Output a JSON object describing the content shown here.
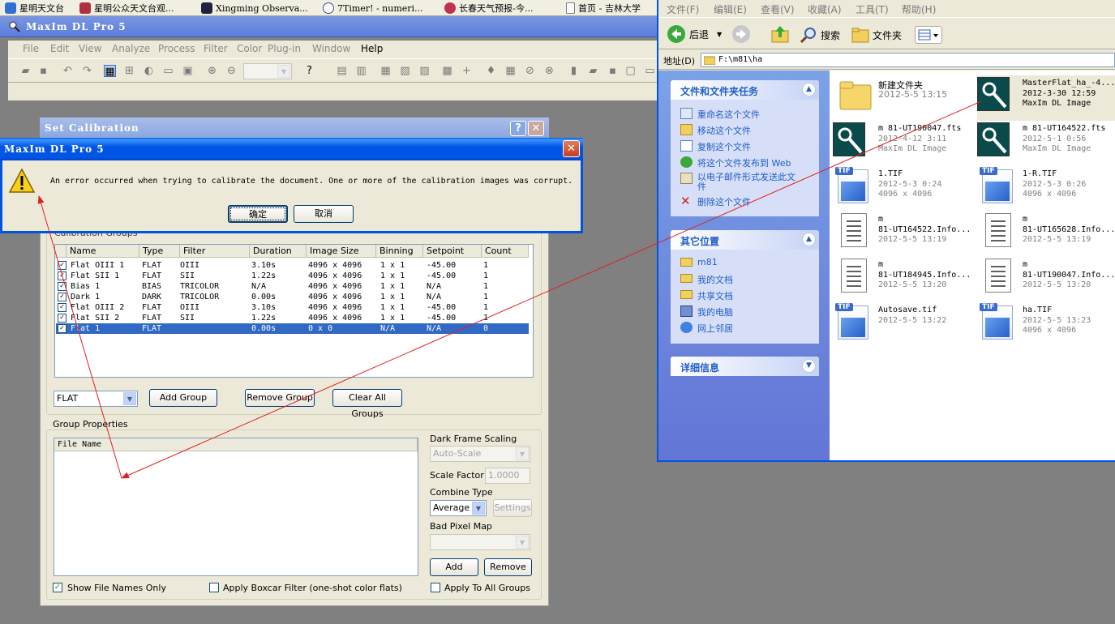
{
  "favorites": [
    {
      "label": "星明天文台",
      "color": "#3070d0"
    },
    {
      "label": "星明公众天文台观...",
      "color": "#b03040"
    },
    {
      "label": "Xingming Observa...",
      "color": "#202040"
    },
    {
      "label": "7Timer! - numeri...",
      "color": "#4040b0"
    },
    {
      "label": "长春天气预报-今...",
      "color": "#c03050"
    },
    {
      "label": "首页 - 吉林大学",
      "color": "#808080"
    }
  ],
  "maxim": {
    "title": "MaxIm DL Pro 5",
    "menu": [
      "File",
      "Edit",
      "View",
      "Analyze",
      "Process",
      "Filter",
      "Color",
      "Plug-in",
      "Window",
      "Help"
    ]
  },
  "set_calibration": {
    "title": "Set Calibration",
    "help_button": "?",
    "close_button": "✕",
    "groups_label": "Calibration Groups",
    "columns": [
      "Name",
      "Type",
      "Filter",
      "Duration",
      "Image Size",
      "Binning",
      "Setpoint",
      "Count"
    ],
    "rows": [
      {
        "checked": true,
        "name": "Flat OIII 1",
        "type": "FLAT",
        "filter": "OIII",
        "duration": "3.10s",
        "size": "4096 x 4096",
        "binning": "1 x 1",
        "setpoint": "-45.00",
        "count": "1",
        "selected": false
      },
      {
        "checked": true,
        "name": "Flat SII 1",
        "type": "FLAT",
        "filter": "SII",
        "duration": "1.22s",
        "size": "4096 x 4096",
        "binning": "1 x 1",
        "setpoint": "-45.00",
        "count": "1",
        "selected": false
      },
      {
        "checked": true,
        "name": "Bias 1",
        "type": "BIAS",
        "filter": "TRICOLOR",
        "duration": "N/A",
        "size": "4096 x 4096",
        "binning": "1 x 1",
        "setpoint": "N/A",
        "count": "1",
        "selected": false
      },
      {
        "checked": true,
        "name": "Dark 1",
        "type": "DARK",
        "filter": "TRICOLOR",
        "duration": "0.00s",
        "size": "4096 x 4096",
        "binning": "1 x 1",
        "setpoint": "N/A",
        "count": "1",
        "selected": false
      },
      {
        "checked": true,
        "name": "Flat OIII 2",
        "type": "FLAT",
        "filter": "OIII",
        "duration": "3.10s",
        "size": "4096 x 4096",
        "binning": "1 x 1",
        "setpoint": "-45.00",
        "count": "1",
        "selected": false
      },
      {
        "checked": true,
        "name": "Flat SII 2",
        "type": "FLAT",
        "filter": "SII",
        "duration": "1.22s",
        "size": "4096 x 4096",
        "binning": "1 x 1",
        "setpoint": "-45.00",
        "count": "1",
        "selected": false
      },
      {
        "checked": true,
        "name": "Flat 1",
        "type": "FLAT",
        "filter": "",
        "duration": "0.00s",
        "size": "0 x 0",
        "binning": "N/A",
        "setpoint": "N/A",
        "count": "0",
        "selected": true
      }
    ],
    "type_select": "FLAT",
    "add_group": "Add Group",
    "remove_group": "Remove Group",
    "clear_all_groups": "Clear All Groups",
    "group_properties": "Group Properties",
    "file_name_header": "File Name",
    "dark_frame_scaling": "Dark Frame Scaling",
    "dark_frame_scaling_value": "Auto-Scale",
    "scale_factor": "Scale Factor",
    "scale_factor_value": "1.0000",
    "combine_type": "Combine Type",
    "combine_type_value": "Average",
    "settings": "Settings",
    "bad_pixel_map": "Bad Pixel Map",
    "bad_pixel_map_value": "",
    "add": "Add",
    "remove": "Remove",
    "show_file_names_only": "Show File Names Only",
    "show_file_names_only_checked": true,
    "apply_boxcar": "Apply Boxcar Filter (one-shot color flats)",
    "apply_boxcar_checked": false,
    "apply_to_all_groups": "Apply To All Groups",
    "apply_to_all_groups_checked": false
  },
  "error_dialog": {
    "title": "MaxIm DL Pro 5",
    "message": "An error occurred when trying to calibrate the document.  One or more of the calibration images was corrupt.",
    "ok": "确定",
    "cancel": "取消",
    "close": "✕"
  },
  "explorer": {
    "menu": [
      "文件(F)",
      "编辑(E)",
      "查看(V)",
      "收藏(A)",
      "工具(T)",
      "帮助(H)"
    ],
    "back": "后退",
    "search": "搜索",
    "folders": "文件夹",
    "address_label": "地址(D)",
    "address": "F:\\m81\\ha",
    "tasks_panel": {
      "title": "文件和文件夹任务",
      "items": [
        "重命名这个文件",
        "移动这个文件",
        "复制这个文件",
        "将这个文件发布到 Web",
        "以电子邮件形式发送此文件",
        "删除这个文件"
      ]
    },
    "places_panel": {
      "title": "其它位置",
      "items": [
        "m81",
        "我的文档",
        "共享文档",
        "我的电脑",
        "网上邻居"
      ]
    },
    "details_panel": {
      "title": "详细信息"
    },
    "files": [
      {
        "kind": "folder",
        "name": "新建文件夹",
        "line1": "2012-5-5 13:15",
        "line2": ""
      },
      {
        "kind": "maxim",
        "name": "MasterFlat_ha_-4...",
        "line1": "2012-3-30 12:59",
        "line2": "MaxIm DL Image",
        "selected": true
      },
      {
        "kind": "maxim",
        "name": "m 81-UT190047.fts",
        "line1": "2012-4-12 3:11",
        "line2": "MaxIm DL Image"
      },
      {
        "kind": "maxim",
        "name": "m 81-UT164522.fts",
        "line1": "2012-5-1 0:56",
        "line2": "MaxIm DL Image"
      },
      {
        "kind": "tif",
        "name": "1.TIF",
        "line1": "2012-5-3 0:24",
        "line2": "4096 x 4096"
      },
      {
        "kind": "tif",
        "name": "1-R.TIF",
        "line1": "2012-5-3 0:26",
        "line2": "4096 x 4096"
      },
      {
        "kind": "txt",
        "name": "m",
        "name2": "81-UT164522.Info...",
        "line1": "2012-5-5 13:19"
      },
      {
        "kind": "txt",
        "name": "m",
        "name2": "81-UT165628.Info...",
        "line1": "2012-5-5 13:19"
      },
      {
        "kind": "txt",
        "name": "m",
        "name2": "81-UT184945.Info...",
        "line1": "2012-5-5 13:20"
      },
      {
        "kind": "txt",
        "name": "m",
        "name2": "81-UT190047.Info...",
        "line1": "2012-5-5 13:20"
      },
      {
        "kind": "tif",
        "name": "Autosave.tif",
        "line1": "2012-5-5 13:22",
        "line2": ""
      },
      {
        "kind": "tif",
        "name": "ha.TIF",
        "line1": "2012-5-5 13:23",
        "line2": "4096 x 4096"
      }
    ]
  },
  "colors": {
    "accent": "#0054e3",
    "selection": "#316ac5",
    "annotation_arrow": "#e02020"
  }
}
